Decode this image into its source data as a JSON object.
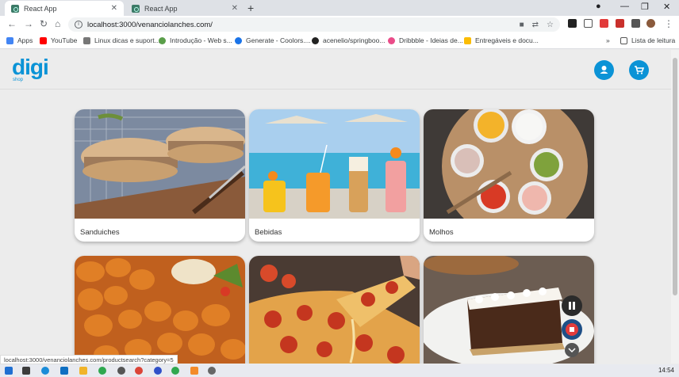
{
  "browser": {
    "tabs": [
      {
        "title": "React App",
        "active": true
      },
      {
        "title": "React App",
        "active": false
      }
    ],
    "url": "localhost:3000/venanciolanches.com/",
    "bookmarks": [
      {
        "label": "Apps",
        "color": "#4285f4"
      },
      {
        "label": "YouTube",
        "color": "#ff0000"
      },
      {
        "label": "Linux dicas e suport...",
        "color": "#777777"
      },
      {
        "label": "Introdução - Web s...",
        "color": "#5a9e4a"
      },
      {
        "label": "Generate - Coolors....",
        "color": "#1a73e8"
      },
      {
        "label": "acenelio/springboo...",
        "color": "#222222"
      },
      {
        "label": "Dribbble - Ideias de...",
        "color": "#ea4c89"
      },
      {
        "label": "Entregáveis e docu...",
        "color": "#fbbc04"
      }
    ],
    "reading_list": "Lista de leitura",
    "status_url": "localhost:3000/venanciolanches.com/productsearch?category=5"
  },
  "app": {
    "logo": "digi",
    "logo_sub": "shop",
    "accent": "#0b93d6",
    "categories": [
      {
        "label": "Sanduiches"
      },
      {
        "label": "Bebidas"
      },
      {
        "label": "Molhos"
      },
      {
        "label": ""
      },
      {
        "label": ""
      },
      {
        "label": ""
      }
    ]
  },
  "taskbar": {
    "time": "14:54"
  }
}
